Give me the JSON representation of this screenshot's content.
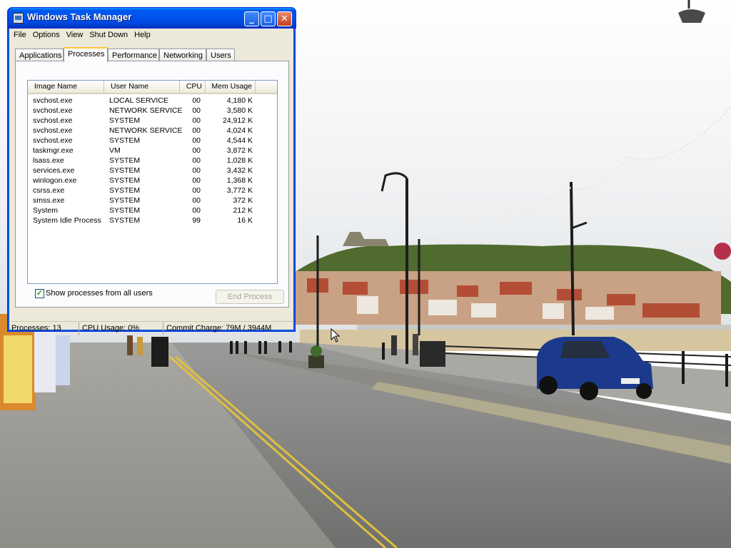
{
  "window": {
    "title": "Windows Task Manager",
    "controls": {
      "minimize": "_",
      "maximize": "□",
      "close": "✕"
    }
  },
  "menu": [
    "File",
    "Options",
    "View",
    "Shut Down",
    "Help"
  ],
  "tabs": [
    {
      "label": "Applications",
      "active": false
    },
    {
      "label": "Processes",
      "active": true
    },
    {
      "label": "Performance",
      "active": false
    },
    {
      "label": "Networking",
      "active": false
    },
    {
      "label": "Users",
      "active": false
    }
  ],
  "processes": {
    "columns": [
      "Image Name",
      "User Name",
      "CPU",
      "Mem Usage"
    ],
    "rows": [
      {
        "image": "svchost.exe",
        "user": "LOCAL SERVICE",
        "cpu": "00",
        "mem": "4,180 K"
      },
      {
        "image": "svchost.exe",
        "user": "NETWORK SERVICE",
        "cpu": "00",
        "mem": "3,580 K"
      },
      {
        "image": "svchost.exe",
        "user": "SYSTEM",
        "cpu": "00",
        "mem": "24,912 K"
      },
      {
        "image": "svchost.exe",
        "user": "NETWORK SERVICE",
        "cpu": "00",
        "mem": "4,024 K"
      },
      {
        "image": "svchost.exe",
        "user": "SYSTEM",
        "cpu": "00",
        "mem": "4,544 K"
      },
      {
        "image": "taskmgr.exe",
        "user": "VM",
        "cpu": "00",
        "mem": "3,872 K"
      },
      {
        "image": "lsass.exe",
        "user": "SYSTEM",
        "cpu": "00",
        "mem": "1,028 K"
      },
      {
        "image": "services.exe",
        "user": "SYSTEM",
        "cpu": "00",
        "mem": "3,432 K"
      },
      {
        "image": "winlogon.exe",
        "user": "SYSTEM",
        "cpu": "00",
        "mem": "1,368 K"
      },
      {
        "image": "csrss.exe",
        "user": "SYSTEM",
        "cpu": "00",
        "mem": "3,772 K"
      },
      {
        "image": "smss.exe",
        "user": "SYSTEM",
        "cpu": "00",
        "mem": "372 K"
      },
      {
        "image": "System",
        "user": "SYSTEM",
        "cpu": "00",
        "mem": "212 K"
      },
      {
        "image": "System Idle Process",
        "user": "SYSTEM",
        "cpu": "99",
        "mem": "16 K"
      }
    ]
  },
  "show_all_users": {
    "label": "Show processes from all users",
    "checked": true
  },
  "end_process": {
    "label": "End Process",
    "enabled": false
  },
  "status": {
    "processes": "Processes: 13",
    "cpu": "CPU Usage: 0%",
    "commit": "Commit Charge: 79M / 3944M"
  },
  "colors": {
    "titlebar": "#0054e3",
    "window_face": "#ece9d8",
    "active_tab_accent": "#ffc83c"
  }
}
